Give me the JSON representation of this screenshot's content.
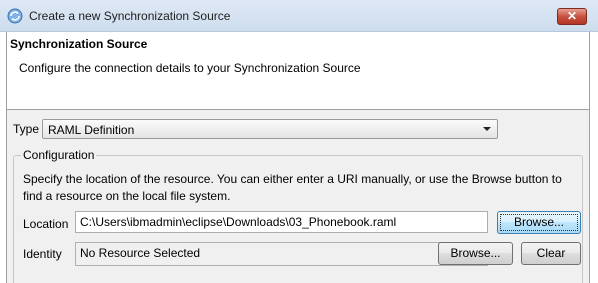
{
  "window": {
    "title": "Create a new Synchronization Source",
    "close_label": "✕"
  },
  "header": {
    "title": "Synchronization Source",
    "description": "Configure the connection details to your Synchronization Source"
  },
  "type": {
    "label": "Type",
    "selected": "RAML Definition"
  },
  "configuration": {
    "legend": "Configuration",
    "description": "Specify the location of the resource.  You can either enter a URI manually, or use the Browse button to find a resource on the local file system.",
    "location": {
      "label": "Location",
      "value": "C:\\Users\\ibmadmin\\eclipse\\Downloads\\03_Phonebook.raml",
      "browse_label": "Browse..."
    },
    "identity": {
      "label": "Identity",
      "value": "No Resource Selected",
      "browse_label": "Browse...",
      "clear_label": "Clear"
    }
  },
  "colors": {
    "close_button": "#c8513f",
    "focus_button": "#bee6fd"
  }
}
